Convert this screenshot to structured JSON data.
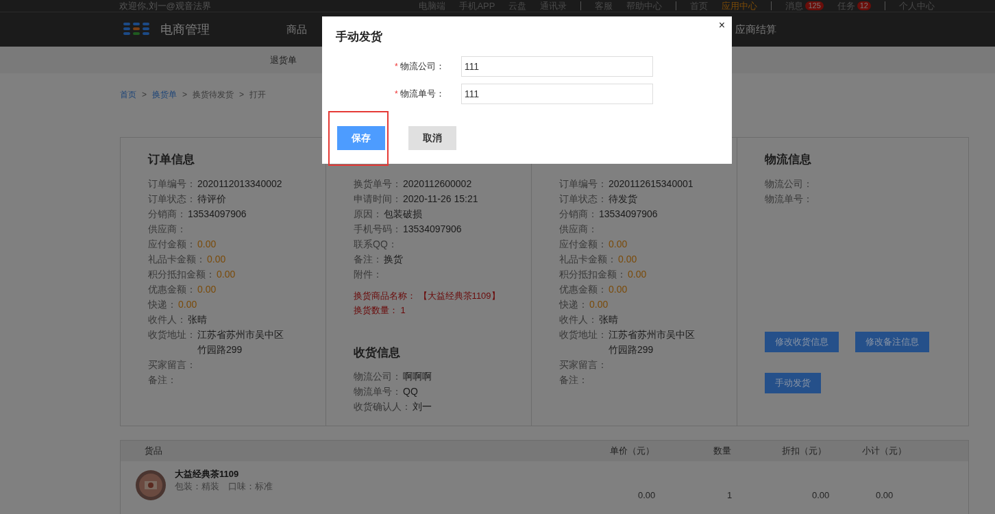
{
  "top_bar": {
    "welcome": "欢迎你,刘一@观音法界",
    "links": [
      {
        "label": "电脑端",
        "selected": false,
        "sep": false
      },
      {
        "label": "手机APP",
        "selected": false,
        "sep": false
      },
      {
        "label": "云盘",
        "selected": false,
        "sep": false
      },
      {
        "label": "通讯录",
        "selected": false,
        "sep": true
      },
      {
        "label": "客服",
        "selected": false,
        "sep": false
      },
      {
        "label": "帮助中心",
        "selected": false,
        "sep": true
      },
      {
        "label": "首页",
        "selected": false,
        "sep": false
      },
      {
        "label": "应用中心",
        "selected": true,
        "sep": true
      },
      {
        "label": "消息",
        "badge": "125",
        "selected": false,
        "sep": false
      },
      {
        "label": "任务",
        "badge": "12",
        "selected": false,
        "sep": true
      },
      {
        "label": "个人中心",
        "selected": false,
        "sep": false
      }
    ]
  },
  "header": {
    "title": "电商管理",
    "nav_left": [
      "商品"
    ],
    "nav_right": [
      "应商结算"
    ]
  },
  "subnav": [
    "退货单"
  ],
  "breadcrumb": {
    "separator": ">",
    "items": [
      {
        "label": "首页",
        "link": true
      },
      {
        "label": "换货单",
        "link": true
      },
      {
        "label": "换货待发货",
        "link": false
      },
      {
        "label": "打开",
        "link": false
      }
    ]
  },
  "columns": [
    {
      "title": "订单信息",
      "rows": [
        {
          "label": "订单编号：",
          "value": "2020112013340002",
          "kind": "plain"
        },
        {
          "label": "订单状态：",
          "value": "待评价",
          "kind": "plain"
        },
        {
          "label": "分销商：",
          "value": "13534097906",
          "kind": "plain"
        },
        {
          "label": "供应商："
        },
        {
          "label": "应付金额：",
          "value": "0.00",
          "kind": "money"
        },
        {
          "label": "礼品卡金额：",
          "value": "0.00",
          "kind": "money"
        },
        {
          "label": "积分抵扣金额：",
          "value": "0.00",
          "kind": "money"
        },
        {
          "label": "优惠金额：",
          "value": "0.00",
          "kind": "money"
        },
        {
          "label": "快递：",
          "value": "0.00",
          "kind": "money"
        },
        {
          "label": "收件人：",
          "value": "张晴",
          "kind": "plain"
        },
        {
          "label": "收货地址：",
          "value": "江苏省苏州市吴中区竹园路299",
          "kind": "address"
        },
        {
          "label": "买家留言："
        },
        {
          "label": "备注："
        }
      ]
    },
    {
      "rows": [
        {
          "label": "换货单号：",
          "value": "2020112600002",
          "kind": "plain"
        },
        {
          "label": "申请时间：",
          "value": "2020-11-26 15:21",
          "kind": "plain"
        },
        {
          "label": "原因：",
          "value": "包装破损",
          "kind": "plain"
        },
        {
          "label": "手机号码：",
          "value": "13534097906",
          "kind": "plain"
        },
        {
          "label": "联系QQ："
        },
        {
          "label": "备注：",
          "value": "换货",
          "kind": "plain"
        },
        {
          "label": "附件："
        }
      ],
      "notes": [
        {
          "label": "换货商品名称：",
          "value": "【大益经典茶1109】"
        },
        {
          "label": "换货数量：",
          "value": "1"
        }
      ],
      "sub_title": "收货信息",
      "sub_rows": [
        {
          "label": "物流公司：",
          "value": "啊啊啊",
          "kind": "plain"
        },
        {
          "label": "物流单号：",
          "value": "QQ",
          "kind": "plain"
        },
        {
          "label": "收货确认人：",
          "value": "刘一",
          "kind": "plain"
        }
      ]
    },
    {
      "rows": [
        {
          "label": "订单编号：",
          "value": "2020112615340001",
          "kind": "plain"
        },
        {
          "label": "订单状态：",
          "value": "待发货",
          "kind": "plain"
        },
        {
          "label": "分销商：",
          "value": "13534097906",
          "kind": "plain"
        },
        {
          "label": "供应商："
        },
        {
          "label": "应付金额：",
          "value": "0.00",
          "kind": "money"
        },
        {
          "label": "礼品卡金额：",
          "value": "0.00",
          "kind": "money"
        },
        {
          "label": "积分抵扣金额：",
          "value": "0.00",
          "kind": "money"
        },
        {
          "label": "优惠金额：",
          "value": "0.00",
          "kind": "money"
        },
        {
          "label": "快递：",
          "value": "0.00",
          "kind": "money"
        },
        {
          "label": "收件人：",
          "value": "张晴",
          "kind": "plain"
        },
        {
          "label": "收货地址：",
          "value": "江苏省苏州市吴中区竹园路299",
          "kind": "address"
        },
        {
          "label": "买家留言："
        },
        {
          "label": "备注："
        }
      ]
    },
    {
      "title": "物流信息",
      "rows": [
        {
          "label": "物流公司："
        },
        {
          "label": "物流单号："
        }
      ],
      "buttons": [
        "修改收货信息",
        "修改备注信息",
        "手动发货"
      ]
    }
  ],
  "table": {
    "columns": [
      "货品",
      "单价（元）",
      "数量",
      "折扣（元）",
      "小计（元）"
    ],
    "rows": [
      {
        "name": "大益经典茶1109",
        "spec": "包装：精装　口味：标准",
        "price": "0.00",
        "qty": "1",
        "discount": "0.00",
        "subtotal": "0.00"
      }
    ]
  },
  "dialog": {
    "title": "手动发货",
    "close": "×",
    "fields": [
      {
        "mark": "*",
        "label": "物流公司：",
        "value": "111"
      },
      {
        "mark": "*",
        "label": "物流单号：",
        "value": "111"
      }
    ],
    "buttons": [
      {
        "label": "保存",
        "kind": "primary",
        "highlighted": true
      },
      {
        "label": "取消",
        "kind": "secondary",
        "highlighted": false
      }
    ]
  }
}
